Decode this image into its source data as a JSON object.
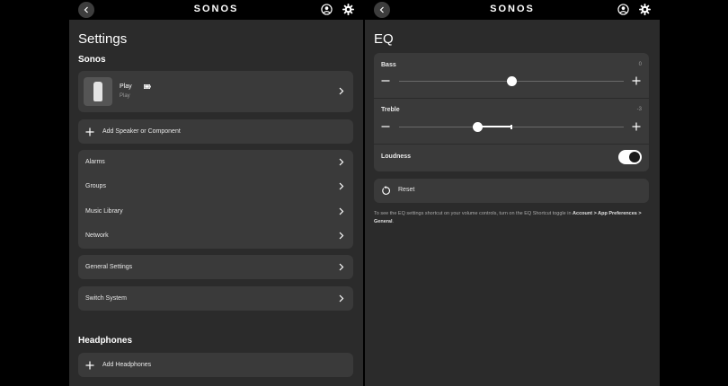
{
  "left": {
    "logo": "SONOS",
    "title": "Settings",
    "section_sonos": "Sonos",
    "speaker": {
      "name": "Play",
      "sub": "Play"
    },
    "add_speaker": "Add Speaker or Component",
    "menu1": [
      {
        "label": "Alarms"
      },
      {
        "label": "Groups"
      },
      {
        "label": "Music Library"
      },
      {
        "label": "Network"
      }
    ],
    "general_settings": "General Settings",
    "switch_system": "Switch System",
    "section_headphones": "Headphones",
    "add_headphones": "Add Headphones"
  },
  "right": {
    "logo": "SONOS",
    "title": "EQ",
    "bass": {
      "label": "Bass",
      "value": "0",
      "fraction": 0.5
    },
    "treble": {
      "label": "Treble",
      "value": "-3",
      "fraction": 0.35
    },
    "loudness": {
      "label": "Loudness",
      "on": true
    },
    "reset": "Reset",
    "help": {
      "pre": "To see the EQ settings shortcut on your volume controls, turn on the EQ Shortcut toggle in ",
      "bold": "Account > App Preferences > General",
      "post": "."
    }
  },
  "colors": {
    "panel": "#2b2b2b",
    "card": "#3a3a3a",
    "topbar": "#000000",
    "accent": "#ffffff"
  },
  "icons": [
    "back-icon",
    "account-icon",
    "gear-icon",
    "chevron-right-icon",
    "plus-icon",
    "minus-icon",
    "battery-icon",
    "reset-icon",
    "speaker-image"
  ]
}
